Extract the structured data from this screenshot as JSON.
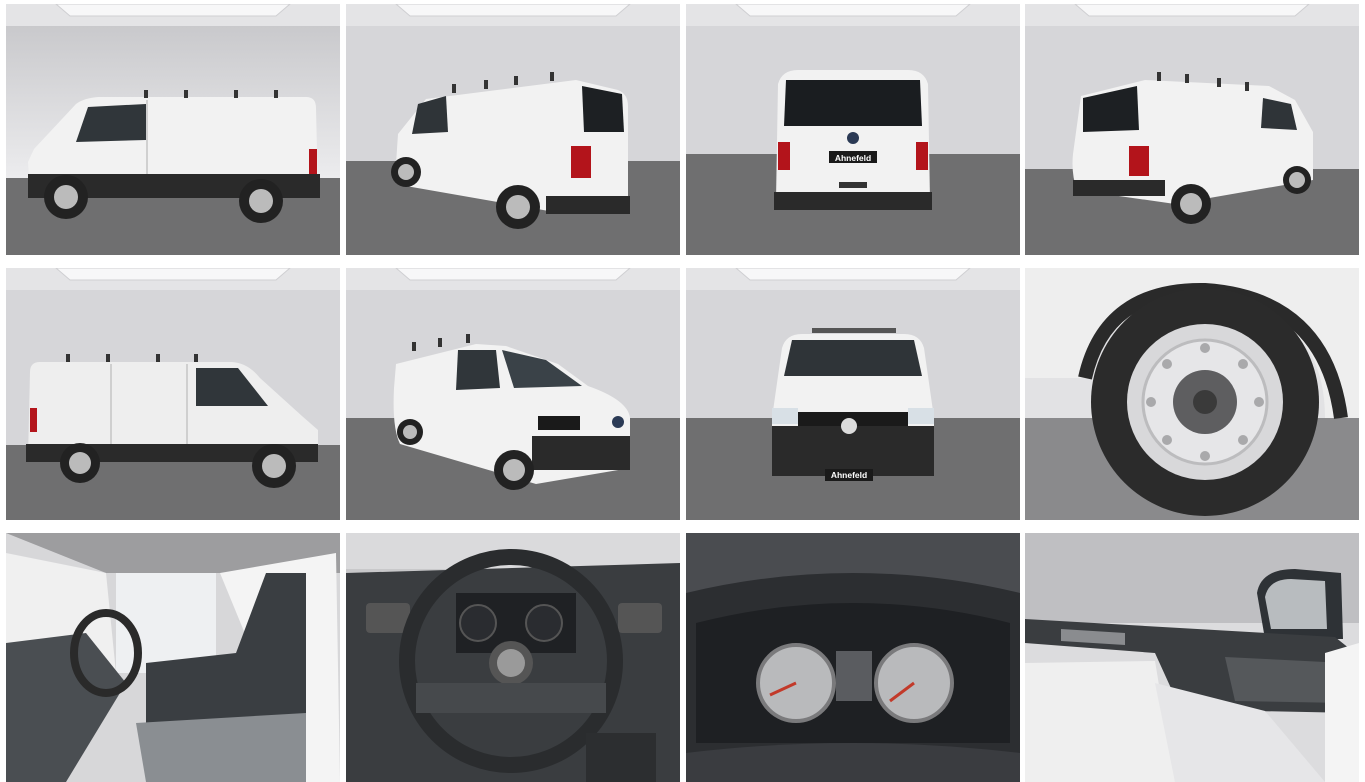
{
  "gallery": {
    "photos": [
      {
        "view": "side-left",
        "plate": ""
      },
      {
        "view": "rear-three-quarter-left",
        "plate": ""
      },
      {
        "view": "rear",
        "plate": "Ahnefeld"
      },
      {
        "view": "rear-three-quarter-right",
        "plate": ""
      },
      {
        "view": "side-right",
        "plate": ""
      },
      {
        "view": "front-three-quarter-right",
        "plate": ""
      },
      {
        "view": "front",
        "plate": "Ahnefeld"
      },
      {
        "view": "wheel-closeup",
        "plate": ""
      },
      {
        "view": "interior-seats",
        "plate": ""
      },
      {
        "view": "steering-wheel",
        "plate": ""
      },
      {
        "view": "instrument-cluster",
        "plate": ""
      },
      {
        "view": "door-panel",
        "plate": ""
      }
    ]
  },
  "colors": {
    "studio_wall": "#d9d9dc",
    "studio_floor": "#6f6f70",
    "van_body": "#f2f2f2",
    "bumper": "#2a2a2a",
    "tail_light": "#b3141b"
  }
}
